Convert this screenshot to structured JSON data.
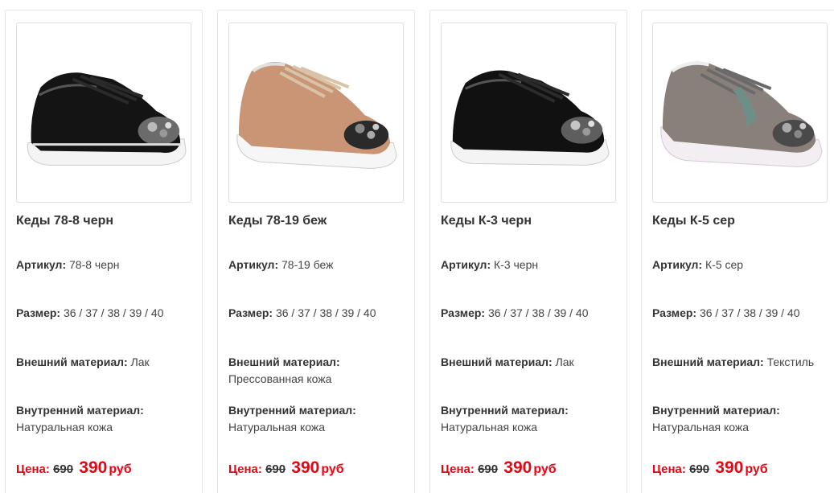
{
  "labels": {
    "article": "Артикул:",
    "size": "Размер:",
    "outer": "Внешний материал:",
    "inner": "Внутренний материал:",
    "price": "Цена:",
    "currency": "руб"
  },
  "colors": {
    "accent": "#e30613",
    "border": "#e4e4e4"
  },
  "products": [
    {
      "image": "sneaker-black-patent",
      "title": "Кеды 78-8 черн",
      "article": "78-8 черн",
      "size": "36 / 37 / 38 / 39 / 40",
      "outer": "Лак",
      "inner": "Натуральная кожа",
      "old_price": "690",
      "new_price": "390"
    },
    {
      "image": "sneaker-beige",
      "title": "Кеды 78-19 беж",
      "article": "78-19 беж",
      "size": "36 / 37 / 38 / 39 / 40",
      "outer": "Прессованная кожа",
      "inner": "Натуральная кожа",
      "old_price": "690",
      "new_price": "390"
    },
    {
      "image": "sneaker-black-croc",
      "title": "Кеды К-3 черн",
      "article": "К-3 черн",
      "size": "36 / 37 / 38 / 39 / 40",
      "outer": "Лак",
      "inner": "Натуральная кожа",
      "old_price": "690",
      "new_price": "390"
    },
    {
      "image": "sneaker-grey-textile",
      "title": "Кеды К-5 сер",
      "article": "К-5 сер",
      "size": "36 / 37 / 38 / 39 / 40",
      "outer": "Текстиль",
      "inner": "Натуральная кожа",
      "old_price": "690",
      "new_price": "390"
    }
  ]
}
